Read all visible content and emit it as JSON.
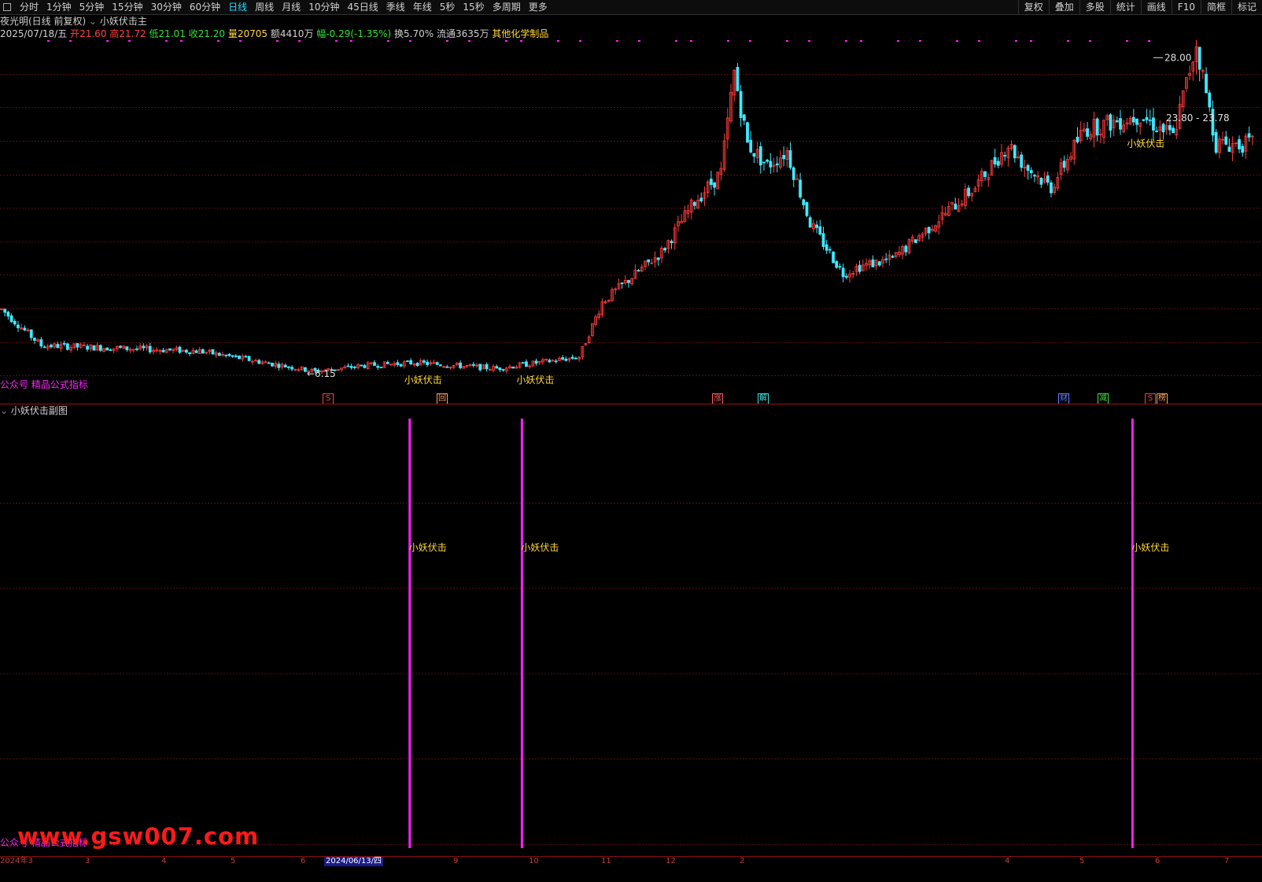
{
  "toolbar": {
    "periods": [
      "分时",
      "1分钟",
      "5分钟",
      "15分钟",
      "30分钟",
      "60分钟",
      "日线",
      "周线",
      "月线",
      "10分钟",
      "45日线",
      "季线",
      "年线",
      "5秒",
      "15秒",
      "多周期",
      "更多"
    ],
    "active_period": "日线",
    "tools": [
      "复权",
      "叠加",
      "多股",
      "统计",
      "画线",
      "F10",
      "简框",
      "标记"
    ]
  },
  "stock": {
    "name": "夜光明(日线 前复权)",
    "indicator_main": "小妖伏击主",
    "date": "2025/07/18/五",
    "open_label": "开",
    "open": "21.60",
    "high_label": "高",
    "high": "21.72",
    "low_label": "低",
    "low": "21.01",
    "close_label": "收",
    "close": "21.20",
    "vol_label": "量",
    "vol": "20705",
    "amount_label": "额",
    "amount": "4410万",
    "change_label": "幅",
    "change": "-0.29(-1.35%)",
    "turnover_label": "换",
    "turnover": "5.70%",
    "float_label": "流通",
    "float": "3635万",
    "industry": "其他化学制品"
  },
  "main_chart": {
    "price_high": "28.00",
    "price_low": "6.15",
    "range_label": "23.80 - 23.78",
    "signal_text": "小妖伏击",
    "watermark_label": "公众号 精品公式指标",
    "event_tags": [
      {
        "text": "S",
        "color": "#ff4040"
      },
      {
        "text": "回",
        "color": "#ffa050"
      },
      {
        "text": "涨",
        "color": "#ff6060"
      },
      {
        "text": "解",
        "color": "#40e0e0"
      },
      {
        "text": "财",
        "color": "#6080ff"
      },
      {
        "text": "减",
        "color": "#40e040"
      },
      {
        "text": "S",
        "color": "#ff4040"
      },
      {
        "text": "榜",
        "color": "#ffa050"
      }
    ]
  },
  "sub_chart": {
    "title": "小妖伏击副图",
    "signal_text": "小妖伏击",
    "pub_label": "公众号 精品公式指标"
  },
  "watermark": "www.gsw007.com",
  "date_axis": {
    "labels": [
      "2024年3",
      "3",
      "4",
      "5",
      "6",
      "9",
      "10",
      "11",
      "12",
      "2",
      "4",
      "5",
      "6",
      "7"
    ],
    "selected": "2024/06/13/四"
  },
  "chart_data": {
    "type": "candlestick",
    "price_range": [
      4.5,
      29.0
    ],
    "marked_high": 28.0,
    "marked_low": 6.15,
    "signal_bars": [
      122,
      156,
      341
    ]
  },
  "colors": {
    "up": "#ff3c3c",
    "down": "#40e8ff",
    "signal": "#ff1fff",
    "label": "#ffd83a"
  }
}
